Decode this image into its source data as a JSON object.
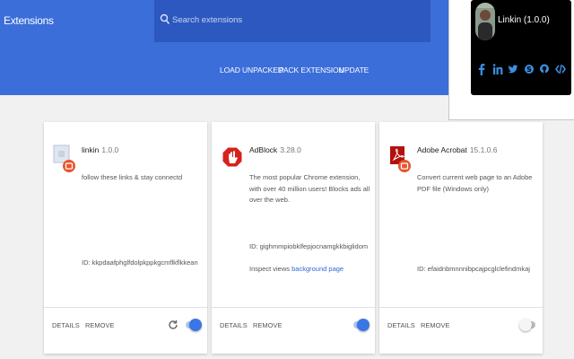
{
  "app_title": "Extensions",
  "search": {
    "placeholder": "Search extensions"
  },
  "toolbar": {
    "load_unpacked": "LOAD UNPACKED",
    "pack_extension": "PACK EXTENSION",
    "update": "UPDATE"
  },
  "popup": {
    "name": "Linkin (1.0.0)",
    "social_icons": [
      "facebook-icon",
      "linkedin-icon",
      "twitter-icon",
      "skype-icon",
      "github-icon",
      "codepen-icon"
    ]
  },
  "extensions": [
    {
      "name": "linkin",
      "version": "1.0.0",
      "description": "follow these links & stay connectd",
      "id_text": "ID: kkpdaafphglfdolpkppkgcmflkflkkean",
      "inspect_label": "",
      "inspect_link": "",
      "details_label": "DETAILS",
      "remove_label": "REMOVE",
      "enabled": true,
      "icon": "puzzle-icon"
    },
    {
      "name": "AdBlock",
      "version": "3.28.0",
      "description": "The most popular Chrome extension, with over 40 million users! Blocks ads all over the web.",
      "id_text": "ID: gighmmpiobklfepjocnamgkkbiglidom",
      "inspect_label": "Inspect views",
      "inspect_link": "background page",
      "details_label": "DETAILS",
      "remove_label": "REMOVE",
      "enabled": true,
      "icon": "adblock-icon"
    },
    {
      "name": "Adobe Acrobat",
      "version": "15.1.0.6",
      "description": "Convert current web page to an Adobe PDF file (Windows only)",
      "id_text": "ID: efaidnbmnnnibpcajpcglclefindmkaj",
      "inspect_label": "",
      "inspect_link": "",
      "details_label": "DETAILS",
      "remove_label": "REMOVE",
      "enabled": false,
      "icon": "acrobat-icon"
    }
  ],
  "colors": {
    "header_blue": "#3b6ed9",
    "search_blue": "#2c58bf",
    "toggle_blue": "#3a77e6",
    "link_blue": "#3367d6"
  }
}
